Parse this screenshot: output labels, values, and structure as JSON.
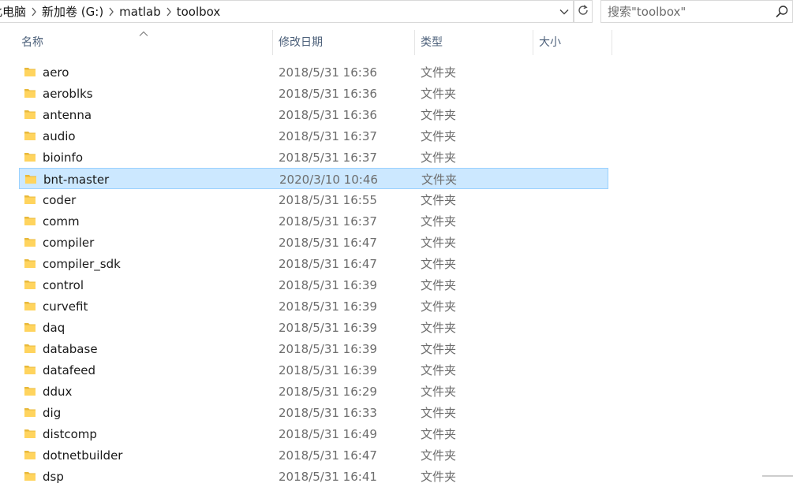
{
  "address_bar": {
    "breadcrumbs": [
      "此电脑",
      "新加卷 (G:)",
      "matlab",
      "toolbox"
    ]
  },
  "search": {
    "placeholder": "搜索\"toolbox\""
  },
  "columns": {
    "name": "名称",
    "date": "修改日期",
    "type": "类型",
    "size": "大小"
  },
  "selected_index": 5,
  "rows": [
    {
      "name": "aero",
      "date": "2018/5/31 16:36",
      "type": "文件夹"
    },
    {
      "name": "aeroblks",
      "date": "2018/5/31 16:36",
      "type": "文件夹"
    },
    {
      "name": "antenna",
      "date": "2018/5/31 16:36",
      "type": "文件夹"
    },
    {
      "name": "audio",
      "date": "2018/5/31 16:37",
      "type": "文件夹"
    },
    {
      "name": "bioinfo",
      "date": "2018/5/31 16:37",
      "type": "文件夹"
    },
    {
      "name": "bnt-master",
      "date": "2020/3/10 10:46",
      "type": "文件夹"
    },
    {
      "name": "coder",
      "date": "2018/5/31 16:55",
      "type": "文件夹"
    },
    {
      "name": "comm",
      "date": "2018/5/31 16:37",
      "type": "文件夹"
    },
    {
      "name": "compiler",
      "date": "2018/5/31 16:47",
      "type": "文件夹"
    },
    {
      "name": "compiler_sdk",
      "date": "2018/5/31 16:47",
      "type": "文件夹"
    },
    {
      "name": "control",
      "date": "2018/5/31 16:39",
      "type": "文件夹"
    },
    {
      "name": "curvefit",
      "date": "2018/5/31 16:39",
      "type": "文件夹"
    },
    {
      "name": "daq",
      "date": "2018/5/31 16:39",
      "type": "文件夹"
    },
    {
      "name": "database",
      "date": "2018/5/31 16:39",
      "type": "文件夹"
    },
    {
      "name": "datafeed",
      "date": "2018/5/31 16:39",
      "type": "文件夹"
    },
    {
      "name": "ddux",
      "date": "2018/5/31 16:29",
      "type": "文件夹"
    },
    {
      "name": "dig",
      "date": "2018/5/31 16:33",
      "type": "文件夹"
    },
    {
      "name": "distcomp",
      "date": "2018/5/31 16:49",
      "type": "文件夹"
    },
    {
      "name": "dotnetbuilder",
      "date": "2018/5/31 16:47",
      "type": "文件夹"
    },
    {
      "name": "dsp",
      "date": "2018/5/31 16:41",
      "type": "文件夹"
    }
  ],
  "colors": {
    "selected_bg": "#cce8ff",
    "selected_border": "#99d1ff",
    "folder": "#ffd45e",
    "header_text": "#4c607a"
  },
  "icons": {
    "folder": "folder-icon",
    "search": "search-icon",
    "refresh": "refresh-icon",
    "dropdown": "chevron-down-icon",
    "separator": "chevron-right-icon",
    "sort": "sort-up-icon"
  }
}
